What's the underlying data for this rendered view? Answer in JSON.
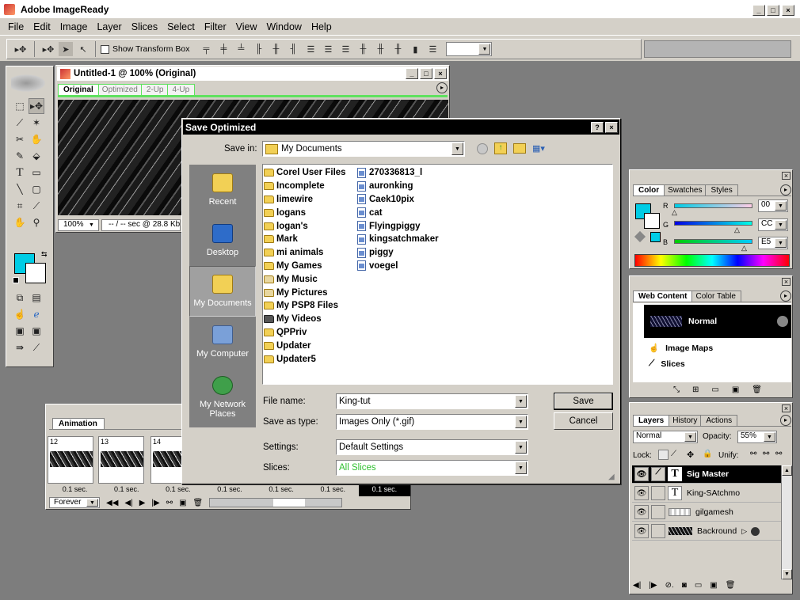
{
  "app": {
    "title": "Adobe ImageReady"
  },
  "menu": [
    "File",
    "Edit",
    "Image",
    "Layer",
    "Slices",
    "Select",
    "Filter",
    "View",
    "Window",
    "Help"
  ],
  "optionsbar": {
    "show_transform_box": "Show Transform Box"
  },
  "doc": {
    "title": "Untitled-1 @ 100% (Original)",
    "tabs": [
      "Original",
      "Optimized",
      "2-Up",
      "4-Up"
    ],
    "zoom": "100%",
    "status": "-- / -- sec @ 28.8 Kbps"
  },
  "dialog": {
    "title": "Save Optimized",
    "save_in_label": "Save in:",
    "save_in_value": "My Documents",
    "places": [
      "Recent",
      "Desktop",
      "My Documents",
      "My Computer",
      "My Network Places"
    ],
    "files_col1": [
      "Corel User Files",
      "Incomplete",
      "limewire",
      "logans",
      "logan's",
      "Mark",
      "mi animals",
      "My Games",
      "My Music",
      "My Pictures",
      "My PSP8 Files",
      "My Videos",
      "QPPriv",
      "Updater",
      "Updater5"
    ],
    "files_col2": [
      "270336813_l",
      "auronking",
      "Caek10pix",
      "cat",
      "Flyingpiggy",
      "kingsatchmaker",
      "piggy",
      "voegel"
    ],
    "file_name_label": "File name:",
    "file_name_value": "King-tut",
    "save_as_label": "Save as type:",
    "save_as_value": "Images Only (*.gif)",
    "settings_label": "Settings:",
    "settings_value": "Default Settings",
    "slices_label": "Slices:",
    "slices_value": "All Slices",
    "save_button": "Save",
    "cancel_button": "Cancel"
  },
  "animation": {
    "tab": "Animation",
    "frames": [
      "12",
      "13",
      "14"
    ],
    "delays": [
      "0.1 sec.",
      "0.1 sec.",
      "0.1 sec.",
      "0.1 sec.",
      "0.1 sec.",
      "0.1 sec.",
      "0.1 sec."
    ],
    "loop": "Forever"
  },
  "color_panel": {
    "tabs": [
      "Color",
      "Swatches",
      "Styles"
    ],
    "r_label": "R",
    "g_label": "G",
    "b_label": "B",
    "r_value": "00",
    "g_value": "CC",
    "b_value": "E5",
    "color": "#00cce5"
  },
  "web_panel": {
    "tabs": [
      "Web Content",
      "Color Table"
    ],
    "normal": "Normal",
    "image_maps": "Image Maps",
    "slices": "Slices"
  },
  "layers_panel": {
    "tabs": [
      "Layers",
      "History",
      "Actions"
    ],
    "blend": "Normal",
    "opacity_label": "Opacity:",
    "opacity_value": "55%",
    "lock_label": "Lock:",
    "unify_label": "Unify:",
    "layers": [
      "Sig Master",
      "King-SAtchmo",
      "gilgamesh",
      "Backround"
    ]
  }
}
